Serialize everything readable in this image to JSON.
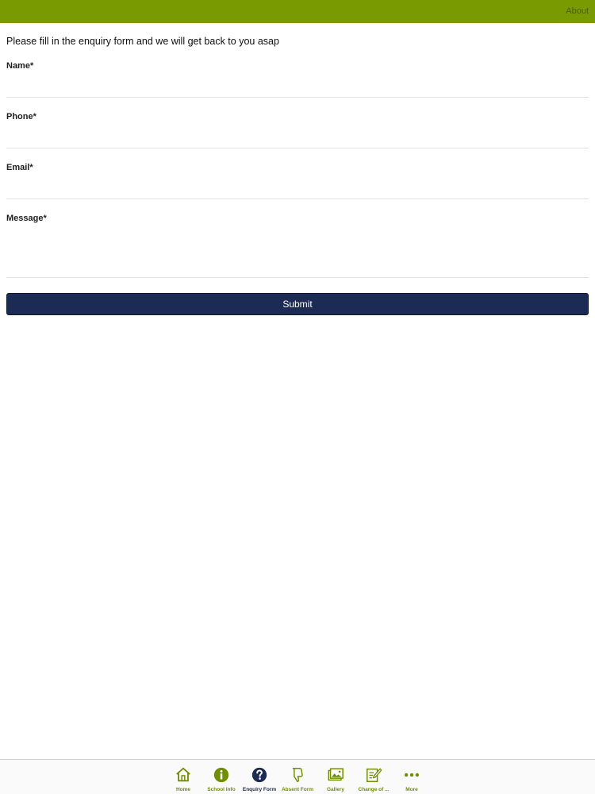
{
  "header": {
    "about_label": "About",
    "bar_color": "#7a9a01"
  },
  "form": {
    "intro": "Please fill in the enquiry form and we will get back to you asap",
    "fields": {
      "name": {
        "label": "Name*",
        "value": ""
      },
      "phone": {
        "label": "Phone*",
        "value": ""
      },
      "email": {
        "label": "Email*",
        "value": ""
      },
      "message": {
        "label": "Message*",
        "value": ""
      }
    },
    "submit_label": "Submit",
    "submit_color": "#1c2b54"
  },
  "tabbar": {
    "accent_color": "#6f8f00",
    "active_color": "#1c2b54",
    "active_tab": "Enquiry Form",
    "tabs": [
      {
        "label": "Home",
        "icon": "home-icon"
      },
      {
        "label": "School Info",
        "icon": "info-icon"
      },
      {
        "label": "Enquiry Form",
        "icon": "question-icon"
      },
      {
        "label": "Absent Form",
        "icon": "thumbs-down-icon"
      },
      {
        "label": "Gallery",
        "icon": "gallery-icon"
      },
      {
        "label": "Change of ...",
        "icon": "edit-icon"
      },
      {
        "label": "More",
        "icon": "more-icon"
      }
    ]
  }
}
